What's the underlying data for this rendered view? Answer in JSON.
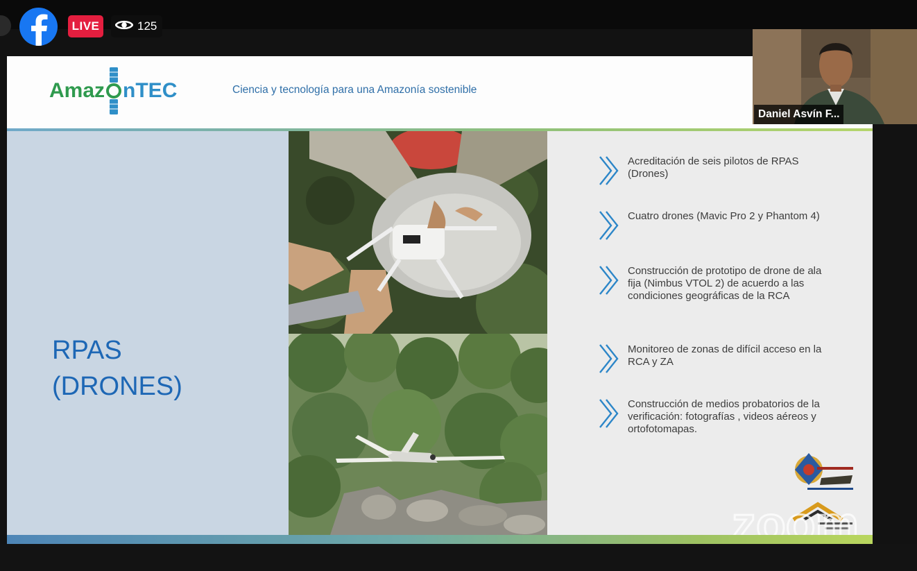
{
  "overlay": {
    "live_label": "LIVE",
    "viewer_count": "125",
    "brand_color": "#1877f2",
    "live_color": "#e41e3f"
  },
  "slide": {
    "logo_left": "Amaz",
    "logo_right": "nTEC",
    "tagline": "Ciencia y tecnología para una Amazonía sostenible",
    "title_line1": "RPAS",
    "title_line2": "(DRONES)",
    "bullets": [
      "Acreditación de seis pilotos de RPAS (Drones)",
      "Cuatro drones (Mavic Pro 2 y Phantom 4)",
      "Construcción de prototipo de drone de ala fija (Nimbus VTOL 2) de acuerdo a las condiciones geográficas de la RCA",
      "Monitoreo de zonas de difícil acceso en la RCA y ZA",
      "Construcción de medios probatorios de la verificación: fotografías , videos aéreos y ortofotomapas."
    ],
    "accent_color": "#1d67b5"
  },
  "participant": {
    "name": "Daniel Asvín F..."
  },
  "watermark": "zoom"
}
